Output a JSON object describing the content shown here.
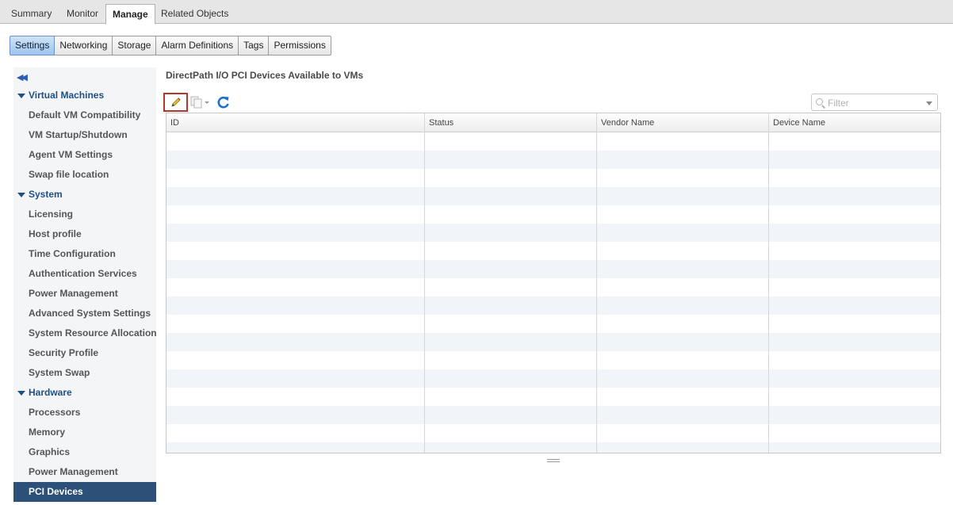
{
  "top_tabs": [
    {
      "label": "Summary"
    },
    {
      "label": "Monitor"
    },
    {
      "label": "Manage"
    },
    {
      "label": "Related Objects"
    }
  ],
  "sub_tabs": [
    {
      "label": "Settings"
    },
    {
      "label": "Networking"
    },
    {
      "label": "Storage"
    },
    {
      "label": "Alarm Definitions"
    },
    {
      "label": "Tags"
    },
    {
      "label": "Permissions"
    }
  ],
  "sidebar": {
    "collapse_icon": "double-chevron-left-icon",
    "groups": [
      {
        "label": "Virtual Machines",
        "items": [
          "Default VM Compatibility",
          "VM Startup/Shutdown",
          "Agent VM Settings",
          "Swap file location"
        ]
      },
      {
        "label": "System",
        "items": [
          "Licensing",
          "Host profile",
          "Time Configuration",
          "Authentication Services",
          "Power Management",
          "Advanced System Settings",
          "System Resource Allocation",
          "Security Profile",
          "System Swap"
        ]
      },
      {
        "label": "Hardware",
        "items": [
          "Processors",
          "Memory",
          "Graphics",
          "Power Management",
          "PCI Devices"
        ]
      }
    ],
    "selected": "PCI Devices"
  },
  "main": {
    "title": "DirectPath I/O PCI Devices Available to VMs",
    "toolbar": {
      "edit_icon": "pencil-icon",
      "copy_icon": "copy-dropdown-icon",
      "refresh_icon": "refresh-icon"
    },
    "filter": {
      "placeholder": "Filter",
      "value": ""
    },
    "table": {
      "columns": [
        "ID",
        "Status",
        "Vendor Name",
        "Device Name"
      ],
      "rows": []
    }
  },
  "colors": {
    "accent_blue": "#1f4f86",
    "selected_nav": "#2d5078",
    "highlight_border": "#b5362a",
    "refresh_blue": "#1a6fd1"
  }
}
